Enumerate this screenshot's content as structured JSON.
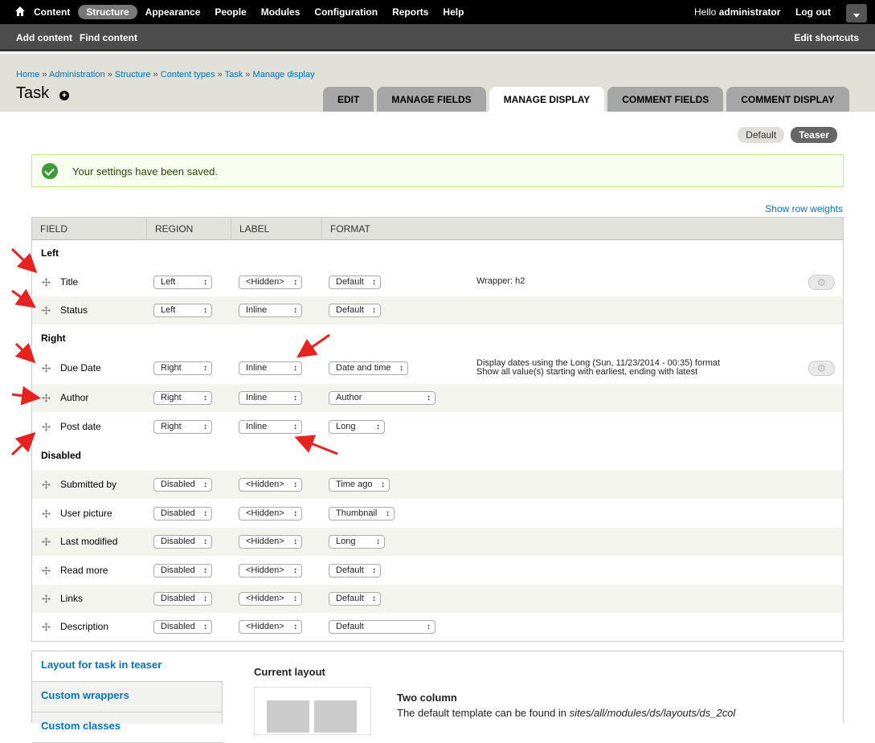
{
  "toolbar": {
    "menu": [
      "Content",
      "Structure",
      "Appearance",
      "People",
      "Modules",
      "Configuration",
      "Reports",
      "Help"
    ],
    "active_menu": "Structure",
    "hello_prefix": "Hello ",
    "username": "administrator",
    "logout": "Log out"
  },
  "shortcuts": {
    "add_content": "Add content",
    "find_content": "Find content",
    "edit_shortcuts": "Edit shortcuts"
  },
  "breadcrumb": [
    "Home",
    "Administration",
    "Structure",
    "Content types",
    "Task",
    "Manage display"
  ],
  "page_title": "Task",
  "tabs": [
    "Edit",
    "Manage fields",
    "Manage display",
    "Comment fields",
    "Comment display"
  ],
  "active_tab": "Manage display",
  "view_modes": [
    "Default",
    "Teaser"
  ],
  "active_view_mode": "Teaser",
  "message": "Your settings have been saved.",
  "show_row_weights": "Show row weights",
  "table": {
    "headers": [
      "Field",
      "Region",
      "Label",
      "Format"
    ],
    "sections": {
      "left": "Left",
      "right": "Right",
      "disabled": "Disabled"
    },
    "rows": [
      {
        "field": "Title",
        "region": "Left",
        "label": "<Hidden>",
        "format": "Default",
        "summary": "Wrapper: h2",
        "summary2": "",
        "gear": true
      },
      {
        "field": "Status",
        "region": "Left",
        "label": "Inline",
        "format": "Default",
        "summary": "",
        "summary2": "",
        "gear": false
      },
      {
        "field": "Due Date",
        "region": "Right",
        "label": "Inline",
        "format": "Date and time",
        "summary": "Display dates using the Long (Sun, 11/23/2014 - 00:35) format",
        "summary2": "Show all value(s) starting with earliest, ending with latest",
        "gear": true
      },
      {
        "field": "Author",
        "region": "Right",
        "label": "Inline",
        "format": "Author",
        "summary": "",
        "summary2": "",
        "gear": false
      },
      {
        "field": "Post date",
        "region": "Right",
        "label": "Inline",
        "format": "Long",
        "summary": "",
        "summary2": "",
        "gear": false
      },
      {
        "field": "Submitted by",
        "region": "Disabled",
        "label": "<Hidden>",
        "format": "Time ago",
        "summary": "",
        "summary2": "",
        "gear": false
      },
      {
        "field": "User picture",
        "region": "Disabled",
        "label": "<Hidden>",
        "format": "Thumbnail",
        "summary": "",
        "summary2": "",
        "gear": false
      },
      {
        "field": "Last modified",
        "region": "Disabled",
        "label": "<Hidden>",
        "format": "Long",
        "summary": "",
        "summary2": "",
        "gear": false
      },
      {
        "field": "Read more",
        "region": "Disabled",
        "label": "<Hidden>",
        "format": "Default",
        "summary": "",
        "summary2": "",
        "gear": false
      },
      {
        "field": "Links",
        "region": "Disabled",
        "label": "<Hidden>",
        "format": "Default",
        "summary": "",
        "summary2": "",
        "gear": false
      },
      {
        "field": "Description",
        "region": "Disabled",
        "label": "<Hidden>",
        "format": "Default",
        "summary": "",
        "summary2": "",
        "gear": false
      }
    ]
  },
  "bottom": {
    "vertical_tabs": [
      "Layout for task in teaser",
      "Custom wrappers",
      "Custom classes"
    ],
    "current_layout_label": "Current layout",
    "layout_name": "Two column",
    "layout_desc_prefix": "The default template can be found in ",
    "layout_desc_path": "sites/all/modules/ds/layouts/ds_2col"
  },
  "colors": {
    "link": "#0074bd",
    "toolbar_bg": "#000000",
    "success_border": "#bbee77",
    "annotation_arrow": "#e8231f"
  }
}
